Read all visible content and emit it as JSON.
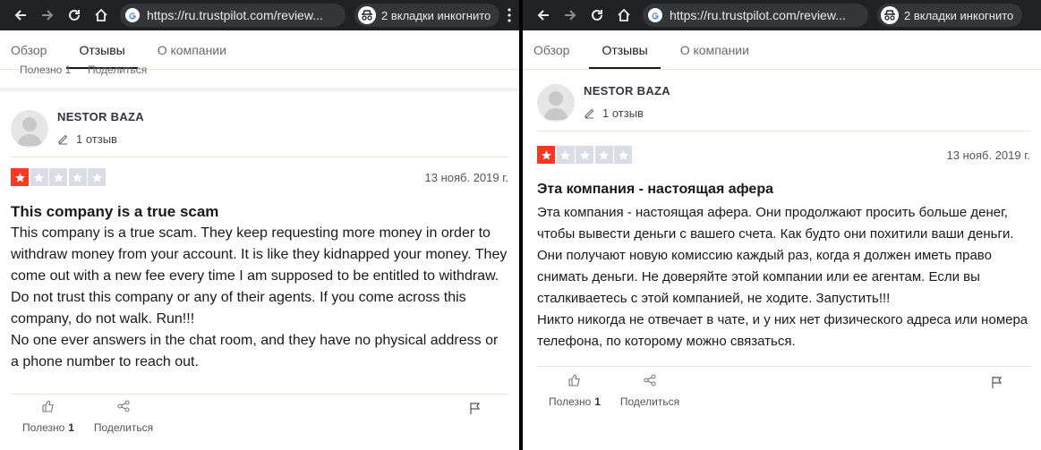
{
  "colors": {
    "star_red": "#ff3722",
    "star_grey": "#dcdce6",
    "browser_bg": "#202124"
  },
  "left": {
    "browser": {
      "url": "https://ru.trustpilot.com/review...",
      "incognito": "2 вкладки инкогнито"
    },
    "tabs": [
      "Обзор",
      "Отзывы",
      "О компании"
    ],
    "previous_actions": {
      "helpful": "Полезно 1",
      "share": "Поделиться"
    },
    "review": {
      "reviewer_name": "NESTOR BAZA",
      "review_count": "1 отзыв",
      "rating": 1,
      "date": "13 нояб. 2019 г.",
      "title": "This company is a true scam",
      "body": "This company is a true scam. They keep requesting more money in order to withdraw money from your account. It is like they kidnapped your money. They come out with a new fee every time I am supposed to be entitled to withdraw. Do not trust this company or any of their agents. If you come across this company, do not walk. Run!!!\nNo one ever answers in the chat room, and they have no physical address or a phone number to reach out.",
      "helpful_label": "Полезно",
      "helpful_count": "1",
      "share_label": "Поделиться"
    }
  },
  "right": {
    "browser": {
      "url": "https://ru.trustpilot.com/review...",
      "incognito": "2 вкладки инкогнито"
    },
    "tabs": [
      "Обзор",
      "Отзывы",
      "О компании"
    ],
    "review": {
      "reviewer_name": "NESTOR BAZA",
      "review_count": "1 отзыв",
      "rating": 1,
      "date": "13 нояб. 2019 г.",
      "title": "Эта компания - настоящая афера",
      "body": "Эта компания - настоящая афера. Они продолжают просить больше денег, чтобы вывести деньги с вашего счета. Как будто они похитили ваши деньги. Они получают новую комиссию каждый раз, когда я должен иметь право снимать деньги. Не доверяйте этой компании или ее агентам. Если вы сталкиваетесь с этой компанией, не ходите. Запустить!!!\nНикто никогда не отвечает в чате, и у них нет физического адреса или номера телефона, по которому можно связаться.",
      "helpful_label": "Полезно",
      "helpful_count": "1",
      "share_label": "Поделиться"
    }
  }
}
